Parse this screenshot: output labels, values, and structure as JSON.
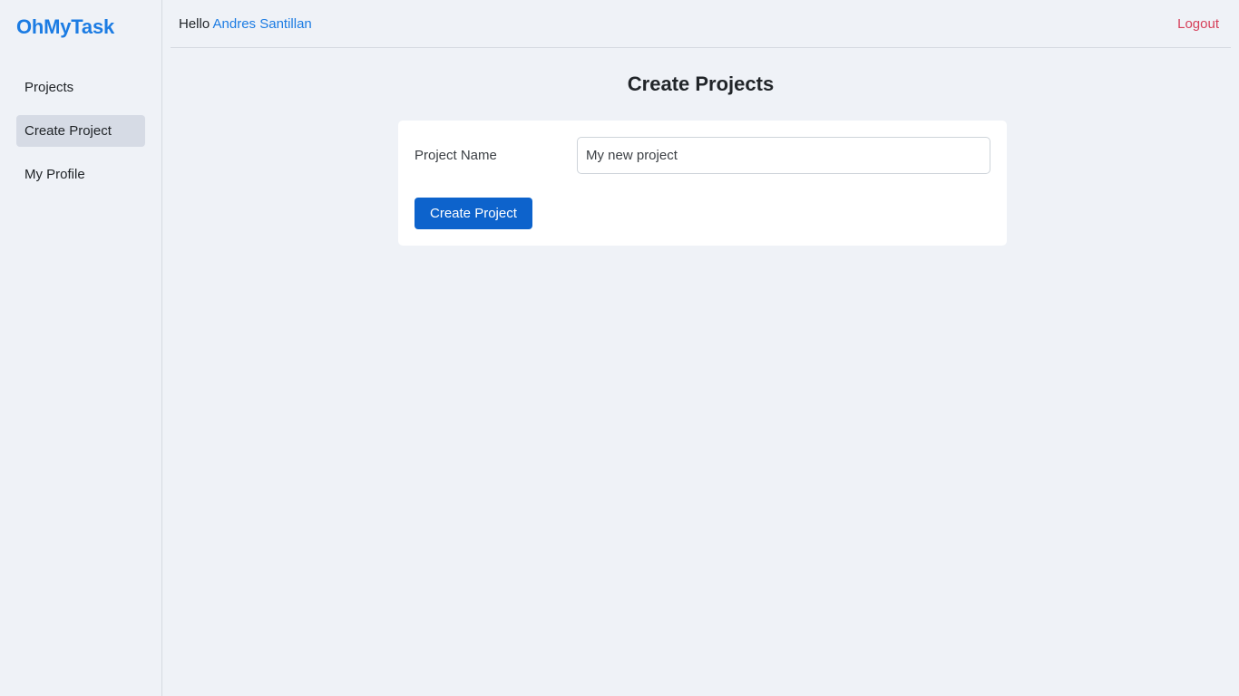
{
  "sidebar": {
    "brand": "OhMyTask",
    "items": [
      {
        "label": "Projects",
        "active": false
      },
      {
        "label": "Create Project",
        "active": true
      },
      {
        "label": "My Profile",
        "active": false
      }
    ]
  },
  "header": {
    "greeting_prefix": "Hello",
    "user_name": "Andres Santillan",
    "logout_label": "Logout"
  },
  "main": {
    "title": "Create Projects",
    "form": {
      "project_name_label": "Project Name",
      "project_name_value": "My new project",
      "submit_label": "Create Project"
    }
  },
  "colors": {
    "brand": "#1c7ce3",
    "primary_button": "#0d63cc",
    "logout": "#d6405a",
    "background": "#eff2f7",
    "active_nav": "#d6dbe5"
  }
}
